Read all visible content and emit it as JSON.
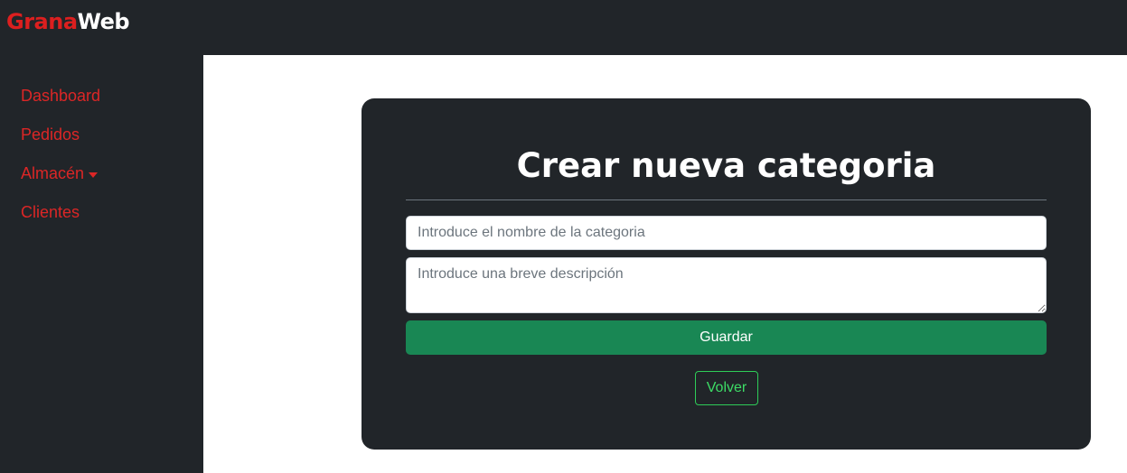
{
  "brand": {
    "part1": "Grana",
    "part2": "Web"
  },
  "sidebar": {
    "items": [
      {
        "label": "Dashboard"
      },
      {
        "label": "Pedidos"
      },
      {
        "label": "Almacén",
        "has_dropdown": true
      },
      {
        "label": "Clientes"
      }
    ]
  },
  "form": {
    "title": "Crear nueva categoria",
    "name_placeholder": "Introduce el nombre de la categoria",
    "name_value": "",
    "description_placeholder": "Introduce una breve descripción",
    "description_value": "",
    "save_label": "Guardar",
    "back_label": "Volver"
  },
  "colors": {
    "dark_bg": "#212529",
    "brand_red": "#dc1f1f",
    "nav_red": "#dc2626",
    "save_green": "#198754",
    "back_green": "#3ddc66"
  }
}
